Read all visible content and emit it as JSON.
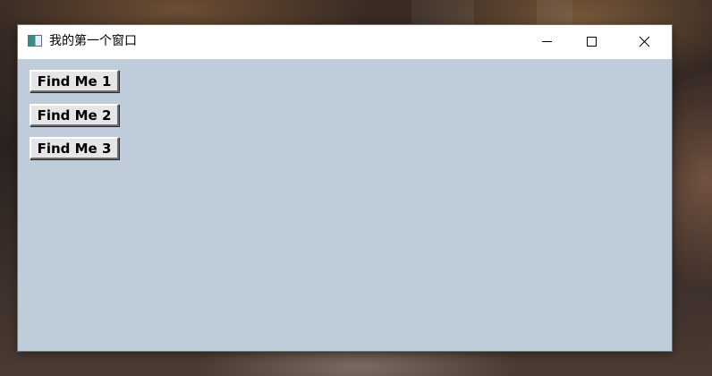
{
  "window": {
    "title": "我的第一个窗口"
  },
  "buttons": [
    {
      "label": "Find Me 1"
    },
    {
      "label": "Find Me 2"
    },
    {
      "label": "Find Me 3"
    }
  ],
  "icons": {
    "app": "app-window-icon",
    "minimize": "minimize-icon",
    "maximize": "maximize-icon",
    "close": "close-icon"
  },
  "colors": {
    "client_background": "#bfcdda",
    "titlebar_background": "#ffffff",
    "button_face": "#e6e6e6"
  }
}
